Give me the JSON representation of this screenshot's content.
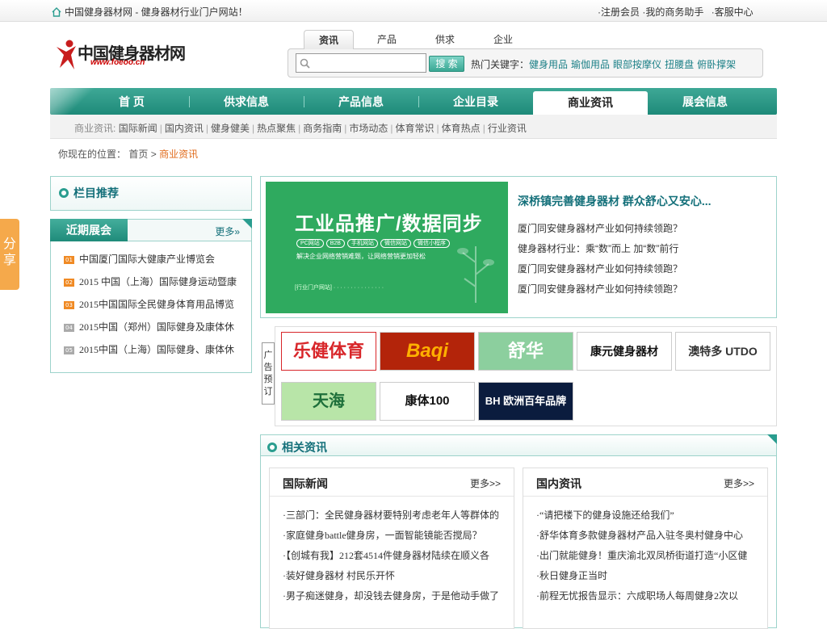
{
  "topbar": {
    "site_title": "中国健身器材网 - 健身器材行业门户网站！",
    "links": [
      "·注册会员",
      "·我的商务助手",
      "·客服中心"
    ]
  },
  "logo": {
    "name": "中国健身器材网",
    "url": "www.foeoo.cn"
  },
  "search": {
    "tabs": [
      "资讯",
      "产品",
      "供求",
      "企业"
    ],
    "active_tab": "资讯",
    "placeholder": "",
    "button": "搜 索",
    "hot_label": "热门关键字：",
    "hot_keywords": [
      "健身用品",
      "瑜伽用品",
      "眼部按摩仪",
      "扭腰盘",
      "俯卧撑架"
    ]
  },
  "nav": {
    "items": [
      "首 页",
      "供求信息",
      "产品信息",
      "企业目录",
      "商业资讯",
      "展会信息"
    ],
    "active": "商业资讯"
  },
  "subnav": {
    "label": "商业资讯:",
    "items": [
      "国际新闻",
      "国内资讯",
      "健身健美",
      "热点聚焦",
      "商务指南",
      "市场动态",
      "体育常识",
      "体育热点",
      "行业资讯"
    ]
  },
  "breadcrumb": {
    "prefix": "你现在的位置：",
    "home": "首页",
    "sep": ">",
    "current": "商业资讯"
  },
  "recommend": {
    "title": "栏目推荐"
  },
  "exhibitions": {
    "title": "近期展会",
    "more": "更多»",
    "items": [
      {
        "num": "01",
        "text": "中国厦门国际大健康产业博览会"
      },
      {
        "num": "02",
        "text": "2015 中国（上海）国际健身运动暨康"
      },
      {
        "num": "03",
        "text": "2015中国国际全民健身体育用品博览"
      },
      {
        "num": "04",
        "text": "2015中国（郑州）国际健身及康体休"
      },
      {
        "num": "05",
        "text": "2015中国（上海）国际健身、康体休"
      }
    ]
  },
  "share": {
    "label": "分享"
  },
  "featured": {
    "banner_title": "工业品推广/数据同步",
    "banner_tags": [
      "PC网站",
      "B2B",
      "手机网站",
      "微信网站",
      "微信小程序"
    ],
    "banner_sub": "解决企业网络营销难题，让网络营销更加轻松",
    "banner_foot": "[行业门户网站] · · · · · · · · · · · · · · ·",
    "headline": "深桥镇完善健身器材 群众舒心又安心...",
    "items": [
      "厦门同安健身器材产业如何持续领跑？",
      "健身器材行业：乘“数”而上 加“数”前行",
      "厦门同安健身器材产业如何持续领跑？",
      "厦门同安健身器材产业如何持续领跑？"
    ]
  },
  "ads": {
    "label": "广告预订",
    "brands": [
      {
        "text": "乐健体育",
        "fg": "#d8262a",
        "bg": "#ffffff"
      },
      {
        "text": "Baqi",
        "fg": "#ffb000",
        "bg": "#b3240a"
      },
      {
        "text": "舒华",
        "fg": "#ffffff",
        "bg": "#8ccf9e"
      },
      {
        "text": "康元健身器材",
        "fg": "#111111",
        "bg": "#ffffff"
      },
      {
        "text": "澳特多 UTDO",
        "fg": "#333333",
        "bg": "#ffffff"
      },
      {
        "text": "天海",
        "fg": "#1d6f3a",
        "bg": "#b8e5a8"
      },
      {
        "text": "康体100 FITNESS",
        "fg": "#111111",
        "bg": "#ffffff"
      },
      {
        "text": "BH 欧洲百年品牌",
        "fg": "#ffffff",
        "bg": "#0b1c3e"
      }
    ]
  },
  "related": {
    "title": "相关资讯",
    "columns": [
      {
        "title": "国际新闻",
        "more": "更多>>",
        "items": [
          "·三部门：全民健身器材要特别考虑老年人等群体的",
          "·家庭健身battle健身房，一面智能镜能否搅局？",
          "·【创城有我】212套4514件健身器材陆续在顺义各",
          "·装好健身器材 村民乐开怀",
          "·男子痴迷健身，却没钱去健身房，于是他动手做了"
        ]
      },
      {
        "title": "国内资讯",
        "more": "更多>>",
        "items": [
          "·“请把楼下的健身设施还给我们”",
          "·舒华体育多款健身器材产品入驻冬奥村健身中心",
          "·出门就能健身！重庆渝北双凤桥街道打造“小区健",
          "·秋日健身正当时",
          "·前程无忧报告显示：六成职场人每周健身2次以"
        ]
      }
    ]
  },
  "colors": {
    "accent": "#1e8a79",
    "link": "#14707a",
    "highlight": "#e06a1a",
    "num_badge": "#f08a24"
  }
}
